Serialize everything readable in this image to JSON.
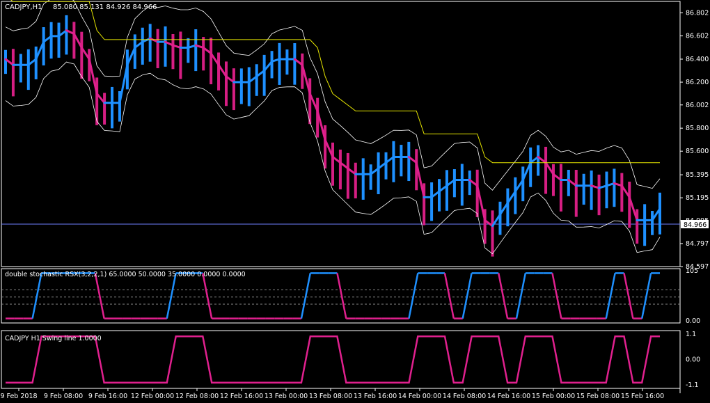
{
  "header": {
    "symbol_label": "CADJPY,H1",
    "ohlc": "85.080 85.131 84.926 84.966"
  },
  "colors": {
    "background": "#000000",
    "frame": "#ffffff",
    "bull": "#1e90ff",
    "bear": "#d61e83",
    "swing": "#e0208e",
    "band": "#ffffff",
    "trail": "#e6e600",
    "price_line": "#7080ff"
  },
  "chart_data": [
    {
      "type": "bar",
      "name": "main",
      "ylim": [
        84.597,
        86.902
      ],
      "y_ticks": [
        "86.802",
        "86.602",
        "86.400",
        "86.200",
        "86.002",
        "85.800",
        "85.600",
        "85.395",
        "85.195",
        "84.995",
        "84.797",
        "84.597"
      ],
      "current_price": "84.966",
      "x_ticks": [
        "9 Feb 2018",
        "9 Feb 08:00",
        "9 Feb 16:00",
        "12 Feb 00:00",
        "12 Feb 08:00",
        "12 Feb 16:00",
        "13 Feb 00:00",
        "13 Feb 08:00",
        "13 Feb 16:00",
        "14 Feb 00:00",
        "14 Feb 08:00",
        "14 Feb 16:00",
        "15 Feb 00:00",
        "15 Feb 08:00",
        "15 Feb 16:00"
      ],
      "close_path": [
        86.4,
        86.35,
        86.35,
        86.35,
        86.4,
        86.55,
        86.6,
        86.6,
        86.65,
        86.62,
        86.5,
        86.4,
        86.1,
        86.02,
        86.02,
        86.02,
        86.35,
        86.5,
        86.55,
        86.58,
        86.55,
        86.55,
        86.52,
        86.5,
        86.5,
        86.52,
        86.5,
        86.45,
        86.35,
        86.25,
        86.2,
        86.2,
        86.2,
        86.25,
        86.3,
        86.38,
        86.4,
        86.4,
        86.4,
        86.35,
        86.1,
        85.95,
        85.7,
        85.55,
        85.5,
        85.45,
        85.4,
        85.4,
        85.4,
        85.45,
        85.5,
        85.55,
        85.55,
        85.55,
        85.5,
        85.2,
        85.2,
        85.25,
        85.3,
        85.35,
        85.35,
        85.35,
        85.3,
        85.0,
        84.95,
        85.05,
        85.15,
        85.25,
        85.35,
        85.5,
        85.55,
        85.5,
        85.4,
        85.35,
        85.35,
        85.3,
        85.3,
        85.3,
        85.28,
        85.3,
        85.32,
        85.3,
        85.2,
        85.0,
        85.0,
        85.0,
        85.1
      ]
    },
    {
      "type": "line",
      "name": "double-stochastic",
      "title": "double stochastic RSX(3,2,2,1) 65.0000 50.0000 35.0000 0.0000 0.0000",
      "ylim": [
        0,
        105
      ],
      "y_ticks": [
        "105",
        "0.00"
      ],
      "levels": [
        65,
        50,
        35
      ]
    },
    {
      "type": "line",
      "name": "swing-line",
      "title": "CADJPY H1 Swing line 1.0000",
      "ylim": [
        -1.1,
        1.1
      ],
      "y_ticks": [
        "1.1",
        "0.00",
        "-1.1"
      ],
      "values": [
        -1,
        -1,
        -1,
        -1,
        1,
        1,
        1,
        1,
        1,
        1,
        1,
        -1,
        -1,
        -1,
        -1,
        -1,
        -1,
        -1,
        -1,
        1,
        1,
        1,
        1,
        -1,
        -1,
        -1,
        -1,
        -1,
        -1,
        -1,
        -1,
        -1,
        -1,
        -1,
        1,
        1,
        1,
        1,
        -1,
        -1,
        -1,
        -1,
        -1,
        -1,
        -1,
        -1,
        1,
        1,
        1,
        1,
        -1,
        -1,
        1,
        1,
        1,
        1,
        -1,
        -1,
        1,
        1,
        1,
        1,
        -1,
        -1,
        -1,
        -1,
        -1,
        -1,
        1,
        1,
        -1,
        -1,
        1,
        1
      ]
    }
  ]
}
